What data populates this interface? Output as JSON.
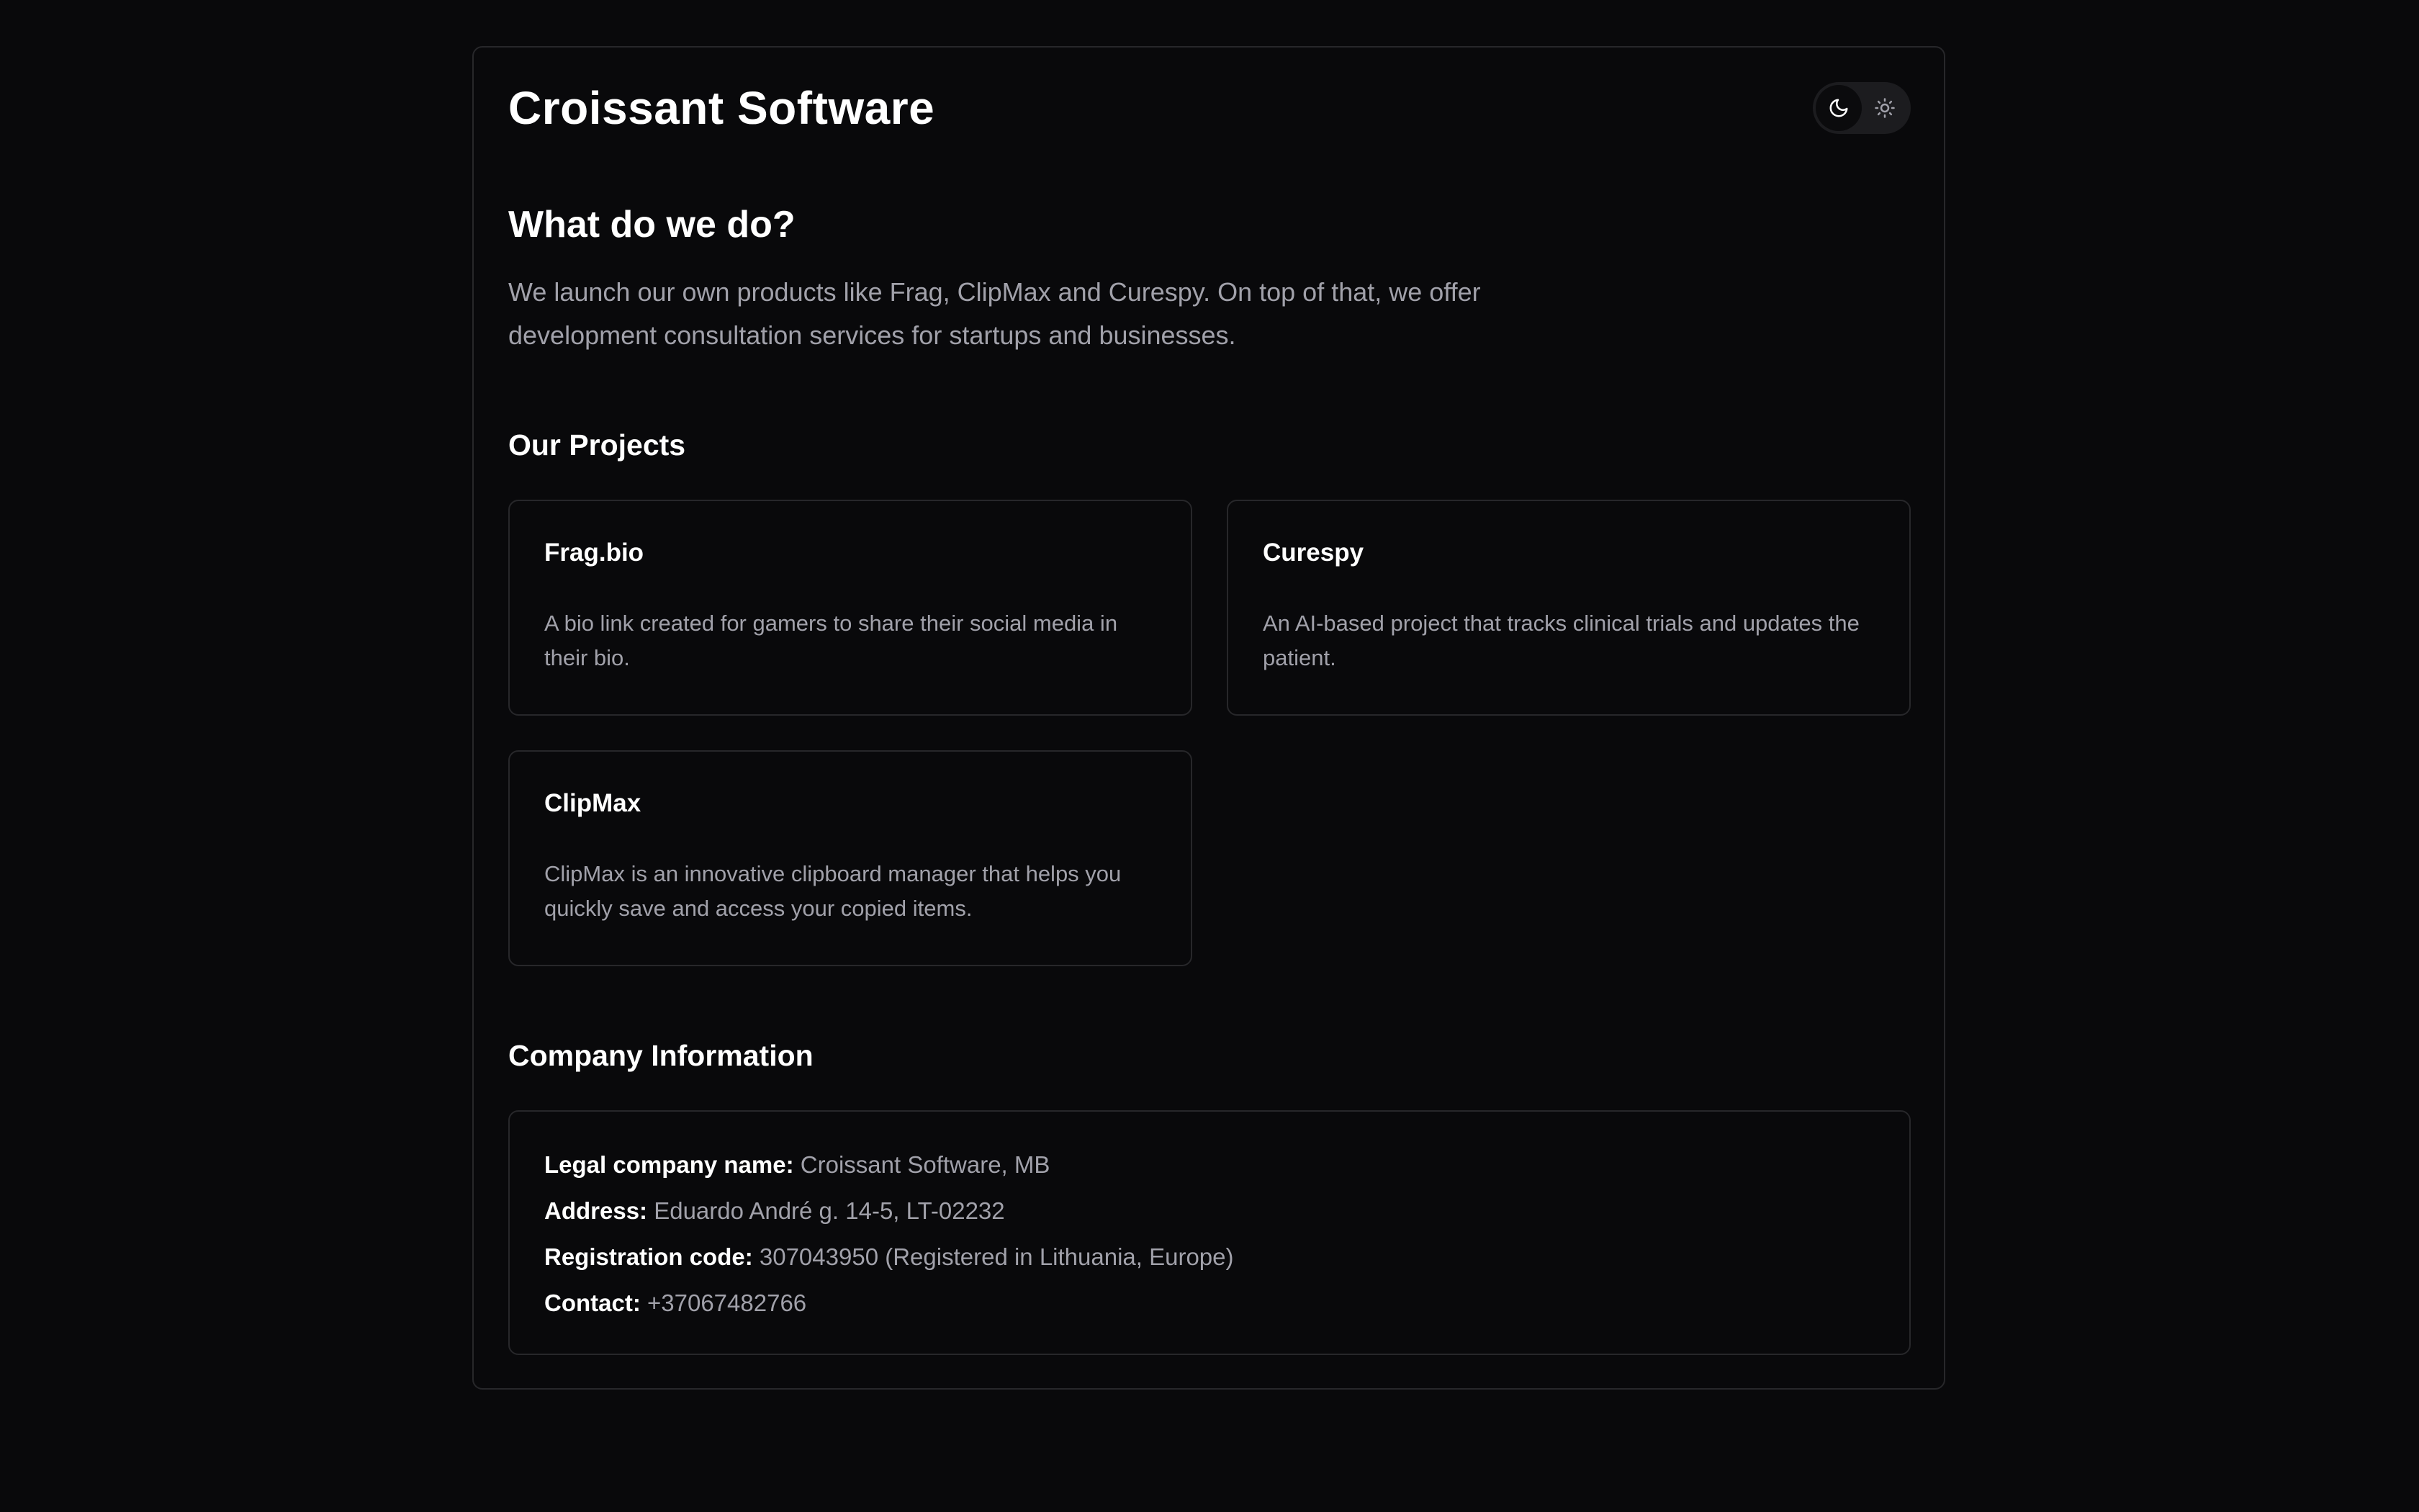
{
  "header": {
    "title": "Croissant Software",
    "theme_toggle": {
      "active": "dark",
      "dark_icon": "moon-icon",
      "light_icon": "sun-icon"
    }
  },
  "about": {
    "heading": "What do we do?",
    "text": "We launch our own products like Frag, ClipMax and Curespy. On top of that, we offer development consultation services for startups and businesses."
  },
  "projects": {
    "heading": "Our Projects",
    "items": [
      {
        "title": "Frag.bio",
        "description": "A bio link created for gamers to share their social media in their bio."
      },
      {
        "title": "Curespy",
        "description": "An AI-based project that tracks clinical trials and updates the patient."
      },
      {
        "title": "ClipMax",
        "description": "ClipMax is an innovative clipboard manager that helps you quickly save and access your copied items."
      }
    ]
  },
  "company": {
    "heading": "Company Information",
    "rows": [
      {
        "label": "Legal company name:",
        "value": "Croissant Software, MB"
      },
      {
        "label": "Address:",
        "value": "Eduardo André g. 14-5, LT-02232"
      },
      {
        "label": "Registration code:",
        "value": "307043950 (Registered in Lithuania, Europe)"
      },
      {
        "label": "Contact:",
        "value": "+37067482766"
      }
    ]
  },
  "colors": {
    "background": "#09090b",
    "border": "#27272a",
    "text": "#ffffff",
    "muted_text": "#a1a1aa"
  }
}
